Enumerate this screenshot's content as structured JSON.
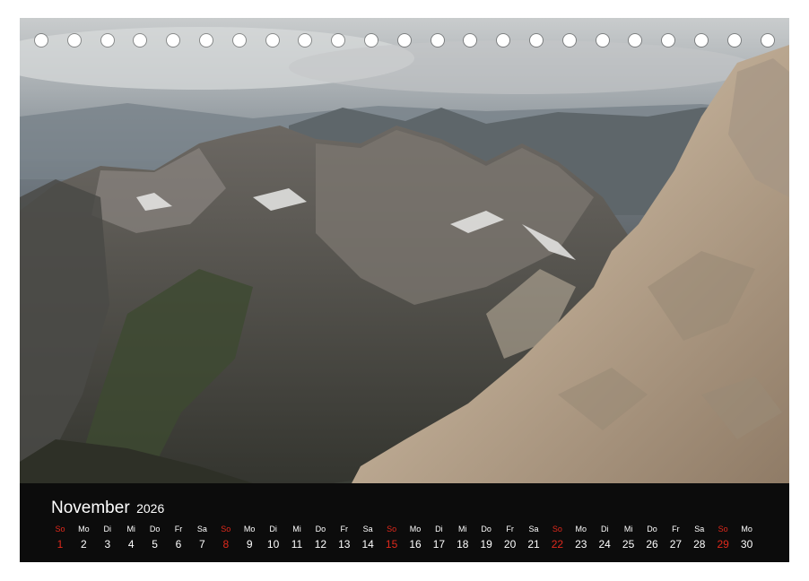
{
  "calendar": {
    "month": "November",
    "year": "2026",
    "accent_color": "#e0291c",
    "days": [
      {
        "dow": "So",
        "num": "1",
        "sunday": true
      },
      {
        "dow": "Mo",
        "num": "2",
        "sunday": false
      },
      {
        "dow": "Di",
        "num": "3",
        "sunday": false
      },
      {
        "dow": "Mi",
        "num": "4",
        "sunday": false
      },
      {
        "dow": "Do",
        "num": "5",
        "sunday": false
      },
      {
        "dow": "Fr",
        "num": "6",
        "sunday": false
      },
      {
        "dow": "Sa",
        "num": "7",
        "sunday": false
      },
      {
        "dow": "So",
        "num": "8",
        "sunday": true
      },
      {
        "dow": "Mo",
        "num": "9",
        "sunday": false
      },
      {
        "dow": "Di",
        "num": "10",
        "sunday": false
      },
      {
        "dow": "Mi",
        "num": "11",
        "sunday": false
      },
      {
        "dow": "Do",
        "num": "12",
        "sunday": false
      },
      {
        "dow": "Fr",
        "num": "13",
        "sunday": false
      },
      {
        "dow": "Sa",
        "num": "14",
        "sunday": false
      },
      {
        "dow": "So",
        "num": "15",
        "sunday": true
      },
      {
        "dow": "Mo",
        "num": "16",
        "sunday": false
      },
      {
        "dow": "Di",
        "num": "17",
        "sunday": false
      },
      {
        "dow": "Mi",
        "num": "18",
        "sunday": false
      },
      {
        "dow": "Do",
        "num": "19",
        "sunday": false
      },
      {
        "dow": "Fr",
        "num": "20",
        "sunday": false
      },
      {
        "dow": "Sa",
        "num": "21",
        "sunday": false
      },
      {
        "dow": "So",
        "num": "22",
        "sunday": true
      },
      {
        "dow": "Mo",
        "num": "23",
        "sunday": false
      },
      {
        "dow": "Di",
        "num": "24",
        "sunday": false
      },
      {
        "dow": "Mi",
        "num": "25",
        "sunday": false
      },
      {
        "dow": "Do",
        "num": "26",
        "sunday": false
      },
      {
        "dow": "Fr",
        "num": "27",
        "sunday": false
      },
      {
        "dow": "Sa",
        "num": "28",
        "sunday": false
      },
      {
        "dow": "So",
        "num": "29",
        "sunday": true
      },
      {
        "dow": "Mo",
        "num": "30",
        "sunday": false
      }
    ]
  },
  "binding": {
    "hole_count": 23
  }
}
